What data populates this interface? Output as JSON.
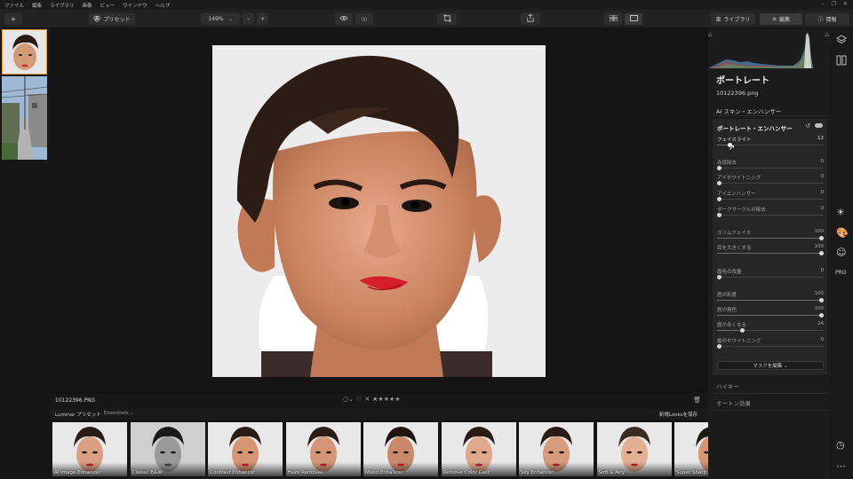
{
  "menu": [
    "ファイル",
    "編集",
    "ライブラリ",
    "画像",
    "ビュー",
    "ウインドウ",
    "ヘルプ"
  ],
  "window_controls": [
    "–",
    "❐",
    "✕"
  ],
  "toolbar": {
    "add_label": "+",
    "presets_label": "プリセット",
    "zoom_label": "149%",
    "zoom_out": "–",
    "zoom_in": "+",
    "compare_label": "▯▯",
    "library_tab": "ライブラリ",
    "edit_tab": "編集",
    "info_tab": "情報"
  },
  "image": {
    "filename": "10122396.PNG",
    "rating_stars": "★★★★★"
  },
  "presetbar": {
    "tab_presets": "Luminar プリセット",
    "tab_essentials": "Essentials",
    "save_looks": "新規Looksを保存"
  },
  "presets": [
    "AI Image Enhancer",
    "Classic B&W",
    "Contrast Enhancer",
    "Haze Removal",
    "Mood Enhancer",
    "Remove Color Cast",
    "Sky Enhancer",
    "Soft & Airy",
    "Super Sharp"
  ],
  "panel": {
    "title": "ポートレート",
    "file": "10122396.png",
    "section_ai_skin": "AI スキン・エンハンサー",
    "card_title": "ポートレート・エンハンサー",
    "mask_button": "マスクを編集 ⌄",
    "section_highkey": "ハイキー",
    "section_orton": "オートン効果"
  },
  "sliders": [
    {
      "label": "フェイスライト",
      "value": "12",
      "level": 0.12,
      "active": true
    },
    {
      "label": "赤目除去",
      "value": "0",
      "level": 0.0
    },
    {
      "label": "アイホワイトニング",
      "value": "0",
      "level": 0.0
    },
    {
      "label": "アイエンハンサー",
      "value": "0",
      "level": 0.0
    },
    {
      "label": "ダークサークルの除去",
      "value": "0",
      "level": 0.0
    },
    {
      "label": "スリムフェイス",
      "value": "100",
      "level": 1.0
    },
    {
      "label": "目を大きくする",
      "value": "100",
      "level": 1.0
    },
    {
      "label": "眉毛の改善",
      "value": "0",
      "level": 0.0
    },
    {
      "label": "唇の彩度",
      "value": "100",
      "level": 1.0
    },
    {
      "label": "唇の発色",
      "value": "100",
      "level": 1.0
    },
    {
      "label": "唇が赤くなる",
      "value": "24",
      "level": 0.24
    },
    {
      "label": "歯のホワイトニング",
      "value": "0",
      "level": 0.0
    }
  ],
  "icons": {
    "histogram_clip_left": "triangle-icon",
    "histogram_clip_right": "triangle-icon",
    "layers": "layers-icon",
    "compare_split": "split-view-icon",
    "sun": "sun-icon",
    "palette": "palette-icon",
    "face": "face-icon",
    "pro_badge": "PRO",
    "history": "clock-icon",
    "more": "ellipsis-icon"
  },
  "colors": {
    "accent_selected_thumb": "#e39a3b",
    "panel_bg": "#1c1c1c",
    "card_bg": "#262626"
  }
}
